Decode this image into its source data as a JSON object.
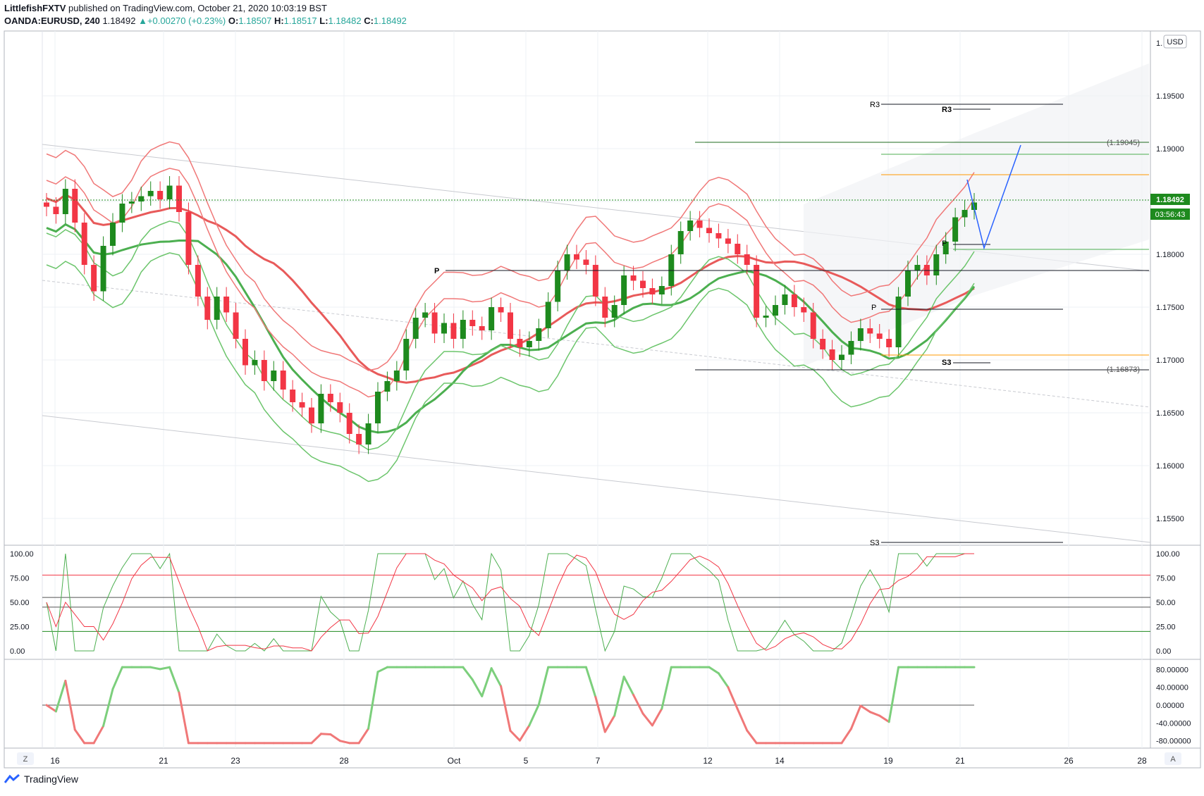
{
  "header": {
    "author": "LittlefishFXTV",
    "published": "published on TradingView.com, October 21, 2020 10:03:19 BST",
    "symbol": "OANDA:EURUSD, 240",
    "last": "1.18492",
    "change": "+0.00270 (+0.23%)",
    "o_label": "O:",
    "o": "1.18507",
    "h_label": "H:",
    "h": "1.18517",
    "l_label": "L:",
    "l": "1.18482",
    "c_label": "C:",
    "c": "1.18492"
  },
  "price_axis": {
    "currency": "USD",
    "labels": [
      "1.19500",
      "1.19000",
      "1.18500",
      "1.18000",
      "1.17500",
      "1.17000",
      "1.16500",
      "1.16000",
      "1.15500"
    ],
    "top_label": "1.",
    "current_price": "1.18492",
    "countdown": "03:56:43"
  },
  "time_axis": {
    "labels": [
      "16",
      "21",
      "23",
      "28",
      "Oct",
      "5",
      "7",
      "12",
      "14",
      "19",
      "21",
      "26",
      "28"
    ],
    "left_button": "Z",
    "right_button": "A"
  },
  "annotations": {
    "pivot_left": "P",
    "pivot_right": "P",
    "pivot_small": "P",
    "r3_a": "R3",
    "r3_b": "R3",
    "s3_a": "S3",
    "s3_b": "S3",
    "level_high": "(1.19045)",
    "level_low": "(1.16873)"
  },
  "stoch_axis": [
    "100.00",
    "75.00",
    "50.00",
    "25.00",
    "0.00"
  ],
  "stoch_axis_left": [
    "100.00",
    "75.00",
    "50.00",
    "25.00",
    "0.00"
  ],
  "osc_axis": [
    "80.00000",
    "40.00000",
    "0.00000",
    "-40.00000",
    "-80.00000"
  ],
  "footer": {
    "brand": "TradingView"
  },
  "colors": {
    "bull": "#1e8a1e",
    "bear": "#f23645",
    "upper_band": "#f07878",
    "lower_band": "#6cc56c",
    "trend": "#2962ff"
  },
  "chart_data": {
    "type": "candlestick",
    "instrument": "OANDA:EURUSD, 240",
    "ylim": [
      1.15,
      1.2
    ],
    "close_series": [
      1.1845,
      1.1838,
      1.1862,
      1.183,
      1.179,
      1.1765,
      1.1808,
      1.183,
      1.1848,
      1.185,
      1.1855,
      1.186,
      1.1852,
      1.1865,
      1.184,
      1.179,
      1.176,
      1.1738,
      1.176,
      1.1745,
      1.172,
      1.1695,
      1.17,
      1.168,
      1.169,
      1.1672,
      1.166,
      1.1655,
      1.164,
      1.1668,
      1.166,
      1.165,
      1.163,
      1.162,
      1.164,
      1.167,
      1.168,
      1.169,
      1.172,
      1.174,
      1.1745,
      1.1725,
      1.1735,
      1.172,
      1.1738,
      1.1732,
      1.1728,
      1.175,
      1.1745,
      1.172,
      1.1712,
      1.1718,
      1.173,
      1.1755,
      1.1785,
      1.18,
      1.1795,
      1.179,
      1.176,
      1.174,
      1.1752,
      1.178,
      1.1775,
      1.1768,
      1.1762,
      1.177,
      1.18,
      1.1822,
      1.1832,
      1.1825,
      1.182,
      1.1815,
      1.181,
      1.18,
      1.179,
      1.174,
      1.1742,
      1.1752,
      1.1762,
      1.175,
      1.1745,
      1.172,
      1.171,
      1.17,
      1.1705,
      1.1718,
      1.173,
      1.1725,
      1.172,
      1.1712,
      1.176,
      1.1785,
      1.179,
      1.178,
      1.18,
      1.1812,
      1.1835,
      1.1842,
      1.1849
    ],
    "stoch_k_last": 95,
    "stoch_d_last": 95,
    "osc_last": 65
  }
}
